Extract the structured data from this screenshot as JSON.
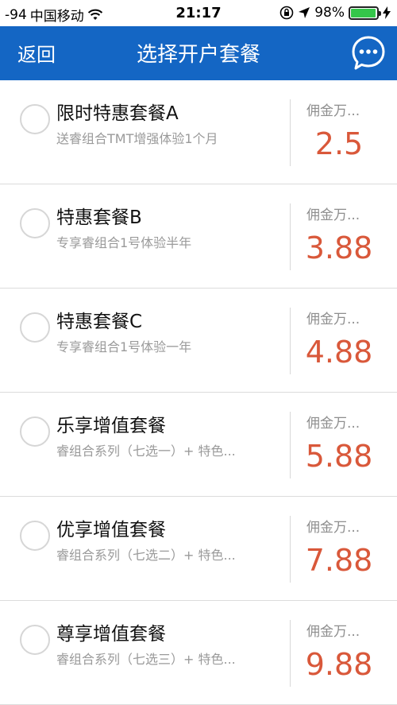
{
  "status_bar": {
    "signal": "-94",
    "carrier": "中国移动",
    "time": "21:17",
    "battery": "98%",
    "battery_level": 0.98
  },
  "nav": {
    "back_label": "返回",
    "title": "选择开户套餐",
    "chat_icon": "chat-bubble-icon"
  },
  "colors": {
    "nav_background": "#1466c4",
    "rate_color": "#d9583a"
  },
  "packages": [
    {
      "title": "限时特惠套餐A",
      "desc": "送睿组合TMT增强体验1个月",
      "rate_label": "佣金万...",
      "rate": "2.5"
    },
    {
      "title": "特惠套餐B",
      "desc": "专享睿组合1号体验半年",
      "rate_label": "佣金万...",
      "rate": "3.88"
    },
    {
      "title": "特惠套餐C",
      "desc": "专享睿组合1号体验一年",
      "rate_label": "佣金万...",
      "rate": "4.88"
    },
    {
      "title": "乐享增值套餐",
      "desc": "睿组合系列（七选一）+ 特色...",
      "rate_label": "佣金万...",
      "rate": "5.88"
    },
    {
      "title": "优享增值套餐",
      "desc": "睿组合系列（七选二）+ 特色...",
      "rate_label": "佣金万...",
      "rate": "7.88"
    },
    {
      "title": "尊享增值套餐",
      "desc": "睿组合系列（七选三）+ 特色...",
      "rate_label": "佣金万...",
      "rate": "9.88"
    }
  ]
}
